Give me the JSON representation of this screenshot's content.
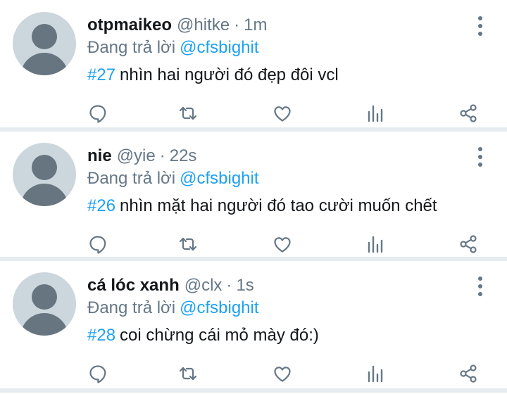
{
  "reply_prefix": "Đang trả lời",
  "colors": {
    "accent": "#1da1f2",
    "secondary_text": "#657786",
    "avatar_bg": "#ccd6dd",
    "separator": "#e6ecf0"
  },
  "icons": [
    "more-vertical-icon",
    "reply-icon",
    "retweet-icon",
    "like-icon",
    "stats-icon",
    "share-icon"
  ],
  "tweets": [
    {
      "name": "otpmaikeo",
      "handle": "@hitke",
      "time": "1m",
      "reply_to": "@cfsbighit",
      "hashtag": "#27",
      "text": "nhìn hai người đó đẹp đôi vcl"
    },
    {
      "name": "nie",
      "handle": "@yie",
      "time": "22s",
      "reply_to": "@cfsbighit",
      "hashtag": "#26",
      "text": "nhìn mặt hai người đó tao cười muốn chết"
    },
    {
      "name": "cá lóc xanh",
      "handle": "@clx",
      "time": "1s",
      "reply_to": "@cfsbighit",
      "hashtag": "#28",
      "text": "coi chừng cái mỏ mày đó:)"
    }
  ]
}
